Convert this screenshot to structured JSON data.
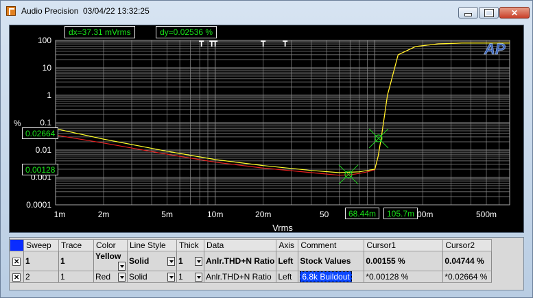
{
  "window": {
    "title": "Audio Precision",
    "datetime": "03/04/22 13:32:25"
  },
  "graph": {
    "dx_readout": "dx=37.31  mVrms",
    "dy_readout": "dy=0.02536  %",
    "y_unit": "%",
    "x_label": "Vrms",
    "t_markers": [
      "T",
      "T",
      "T",
      "T",
      "T"
    ],
    "cursor_y_high": "0.02664",
    "cursor_y_low": "0.00128",
    "cursor_x1": "68.44m",
    "cursor_x2": "105.7m",
    "logo": "AP",
    "colors": {
      "grid": "#8c8c8c",
      "yellow": "#ffff2a",
      "red": "#e82020",
      "cursor": "#22cc22"
    }
  },
  "chart_data": {
    "type": "line",
    "title": "",
    "xlabel": "Vrms",
    "ylabel": "%",
    "x_scale": "log",
    "y_scale": "log",
    "xlim": [
      0.001,
      0.7
    ],
    "ylim": [
      0.0001,
      100
    ],
    "x_tick_labels": [
      "1m",
      "2m",
      "5m",
      "10m",
      "20m",
      "50",
      "200m",
      "500m"
    ],
    "y_tick_labels": [
      "100",
      "10",
      "1",
      "0.1",
      "0.01",
      "0.001",
      "0.0001"
    ],
    "grid": true,
    "series": [
      {
        "color": "#ffff2a",
        "x": [
          0.001,
          0.002,
          0.005,
          0.01,
          0.02,
          0.04,
          0.06,
          0.07,
          0.08,
          0.09,
          0.1,
          0.105,
          0.11,
          0.12,
          0.14,
          0.18,
          0.25,
          0.35,
          0.5,
          0.7
        ],
        "y": [
          0.06,
          0.025,
          0.009,
          0.0045,
          0.0027,
          0.0018,
          0.0015,
          0.00155,
          0.0016,
          0.0018,
          0.002,
          0.006,
          0.03,
          1.0,
          30,
          60,
          75,
          80,
          80,
          80
        ]
      },
      {
        "color": "#e82020",
        "x": [
          0.001,
          0.002,
          0.005,
          0.01,
          0.02,
          0.04,
          0.06,
          0.07,
          0.08,
          0.09,
          0.1,
          0.105,
          0.11,
          0.12,
          0.14,
          0.18,
          0.25,
          0.35,
          0.5,
          0.7
        ],
        "y": [
          0.035,
          0.018,
          0.007,
          0.0036,
          0.0022,
          0.0015,
          0.0012,
          0.00125,
          0.0014,
          0.0016,
          0.0019,
          0.006,
          0.03,
          1.0,
          30,
          60,
          75,
          80,
          80,
          80
        ]
      }
    ],
    "cursors": [
      {
        "x": 0.0684,
        "y": 0.00128
      },
      {
        "x": 0.1057,
        "y": 0.02664
      }
    ]
  },
  "legend": {
    "headers": [
      "Sweep",
      "Trace",
      "Color",
      "Line Style",
      "Thick",
      "Data",
      "Axis",
      "Comment",
      "Cursor1",
      "Cursor2"
    ],
    "rows": [
      {
        "sweep": "1",
        "trace": "1",
        "color": "Yellow",
        "style": "Solid",
        "thick": "1",
        "data": "Anlr.THD+N Ratio",
        "axis": "Left",
        "comment": "Stock Values",
        "cursor1": "0.00155  %",
        "cursor2": "0.04744  %"
      },
      {
        "sweep": "2",
        "trace": "1",
        "color": "Red",
        "style": "Solid",
        "thick": "1",
        "data": "Anlr.THD+N Ratio",
        "axis": "Left",
        "comment": "6.8k Buildout",
        "cursor1": "*0.00128  %",
        "cursor2": "*0.02664  %"
      }
    ],
    "row_mark": "✕"
  }
}
